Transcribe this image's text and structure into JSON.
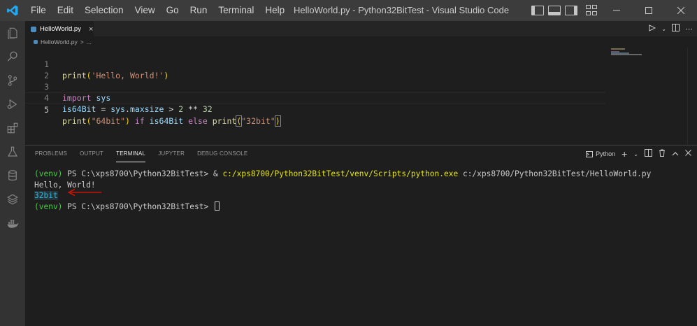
{
  "menu": [
    "File",
    "Edit",
    "Selection",
    "View",
    "Go",
    "Run",
    "Terminal",
    "Help"
  ],
  "window_title": "HelloWorld.py - Python32BitTest - Visual Studio Code",
  "tab": {
    "label": "HelloWorld.py",
    "close": "×"
  },
  "breadcrumb": {
    "file": "HelloWorld.py",
    "sep": ">",
    "rest": "..."
  },
  "code": {
    "line_numbers": [
      "1",
      "2",
      "3",
      "4",
      "5"
    ],
    "l1": {
      "fn": "print",
      "open": "(",
      "str": "'Hello, World!'",
      "close": ")"
    },
    "l3": {
      "kw": "import",
      "mod": "sys"
    },
    "l4": {
      "var": "is64Bit",
      "eq": " = ",
      "obj": "sys",
      "dot": ".",
      "attr": "maxsize",
      "gt": " > ",
      "n1": "2",
      "pow": " ** ",
      "n2": "32"
    },
    "l5": {
      "fn": "print",
      "open": "(",
      "s1": "\"64bit\"",
      "close": ")",
      "kw1": " if ",
      "var": "is64Bit",
      "kw2": " else ",
      "fn2": "print",
      "open2": "(",
      "s2": "\"32bit\"",
      "close2": ")"
    }
  },
  "panel": {
    "tabs": [
      "PROBLEMS",
      "OUTPUT",
      "TERMINAL",
      "JUPYTER",
      "DEBUG CONSOLE"
    ],
    "active_tab": "TERMINAL",
    "terminal_name": "Python"
  },
  "terminal": {
    "l1_venv": "(venv)",
    "l1_prompt": " PS C:\\xps8700\\Python32BitTest> & ",
    "l1_path": "c:/xps8700/Python32BitTest/venv/Scripts/python.exe",
    "l1_arg": " c:/xps8700/Python32BitTest/HelloWorld.py",
    "l2": "Hello, World!",
    "l3": "32bit",
    "l4_venv": "(venv)",
    "l4_prompt": " PS C:\\xps8700\\Python32BitTest> "
  },
  "colors": {
    "accent": "#007acc",
    "annotation": "#e51400"
  }
}
